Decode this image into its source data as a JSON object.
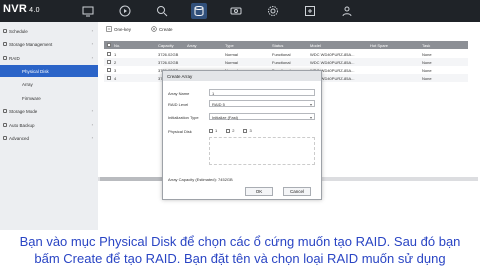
{
  "app": {
    "logo": "NVR",
    "version": "4.0"
  },
  "topbar_icons": [
    {
      "icon": "live-view-icon",
      "active": false
    },
    {
      "icon": "playback-icon",
      "active": false
    },
    {
      "icon": "search-icon",
      "active": false
    },
    {
      "icon": "storage-icon",
      "active": true
    },
    {
      "icon": "camera-icon",
      "active": false
    },
    {
      "icon": "settings-icon",
      "active": false
    },
    {
      "icon": "maintenance-icon",
      "active": false
    },
    {
      "icon": "account-icon",
      "active": false
    }
  ],
  "sidebar": {
    "items": [
      {
        "label": "Schedule",
        "type": "top"
      },
      {
        "label": "Storage Management",
        "type": "top"
      },
      {
        "label": "RAID",
        "type": "top"
      },
      {
        "label": "Physical Disk",
        "type": "sub",
        "active": true
      },
      {
        "label": "Array",
        "type": "sub"
      },
      {
        "label": "Firmware",
        "type": "sub"
      },
      {
        "label": "Storage Mode",
        "type": "top"
      },
      {
        "label": "Auto Backup",
        "type": "top"
      },
      {
        "label": "Advanced",
        "type": "top"
      }
    ]
  },
  "toolbar": {
    "one_key_label": "One-key",
    "create_label": "Create"
  },
  "table": {
    "headers": [
      "No.",
      "Capacity",
      "Array",
      "Type",
      "Status",
      "Model",
      "Hot Spare",
      "Task"
    ],
    "rows": [
      {
        "no": "1",
        "capacity": "3726.02GB",
        "array": "",
        "type": "Normal",
        "status": "Functional",
        "model": "WDC WD40PURZ-85A...",
        "hot_spare": "",
        "task": "None"
      },
      {
        "no": "2",
        "capacity": "3726.02GB",
        "array": "",
        "type": "Normal",
        "status": "Functional",
        "model": "WDC WD40PURZ-85A...",
        "hot_spare": "",
        "task": "None"
      },
      {
        "no": "3",
        "capacity": "3726.02GB",
        "array": "",
        "type": "Normal",
        "status": "Functional",
        "model": "WDC WD40PURZ-85A...",
        "hot_spare": "",
        "task": "None"
      },
      {
        "no": "4",
        "capacity": "3726.02GB",
        "array": "",
        "type": "Normal",
        "status": "Functional",
        "model": "WDC WD40PURZ-85A...",
        "hot_spare": "",
        "task": "None"
      }
    ]
  },
  "dialog": {
    "title": "Create Array",
    "array_name_label": "Array Name",
    "array_name_value": "1",
    "raid_level_label": "RAID Level",
    "raid_level_value": "RAID 5",
    "init_type_label": "Initialization Type",
    "init_type_value": "Initialize (Fast)",
    "physical_disk_label": "Physical Disk",
    "disks": [
      "1",
      "2",
      "3"
    ],
    "capacity_label": "Array Capacity (Estimated): 7452GB",
    "ok_label": "OK",
    "cancel_label": "Cancel"
  },
  "caption": {
    "line1": "Bạn vào mục Physical Disk để chọn các ổ cứng muốn tạo RAID. Sau đó bạn",
    "line2": "bấm Create để tạo RAID. Bạn đặt tên và chọn loại RAID muốn sử dụng"
  },
  "colors": {
    "topbar": "#1f2328",
    "active_nav": "#2b64c8",
    "caption": "#2a45c4",
    "table_header": "#8c8f95"
  }
}
